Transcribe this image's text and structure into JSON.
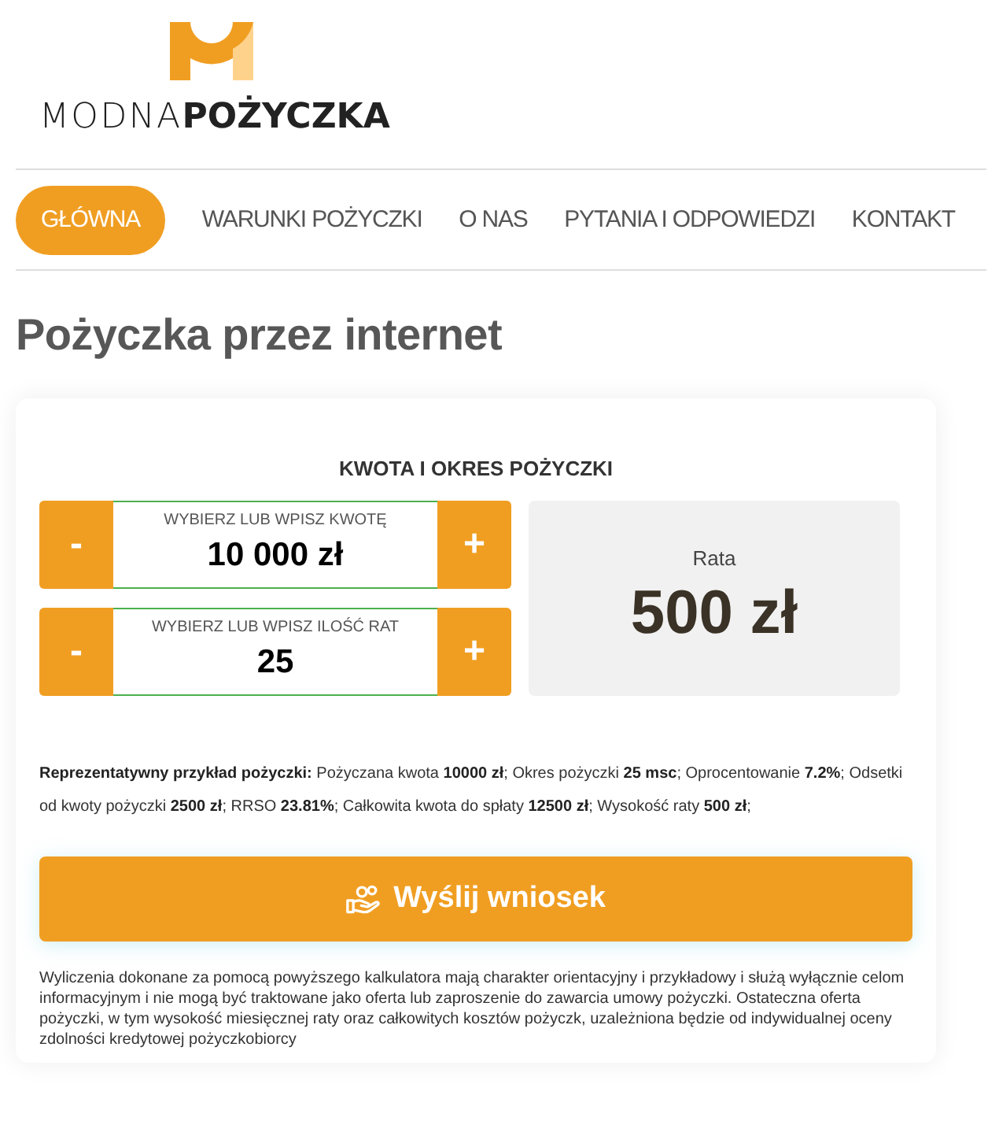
{
  "logo": {
    "text": "MODNA**POŻYCZKA**"
  },
  "nav": [
    {
      "label": "GŁÓWNA",
      "selected": true
    },
    {
      "label": "WARUNKI POŻYCZKI",
      "selected": false
    },
    {
      "label": "O NAS",
      "selected": false
    },
    {
      "label": "PYTANIA I ODPOWIEDZI",
      "selected": false
    },
    {
      "label": "KONTAKT",
      "selected": false
    }
  ],
  "page_title": "Pożyczka przez internet",
  "calculator": {
    "heading": "KWOTA I OKRES POŻYCZKI",
    "steppers": [
      {
        "label": "WYBIERZ LUB WPISZ KWOTĘ",
        "value": "10 000 zł",
        "minus": "-",
        "plus": "+"
      },
      {
        "label": "WYBIERZ LUB WPISZ ILOŚĆ RAT",
        "value": "25",
        "minus": "-",
        "plus": "+"
      }
    ],
    "result": {
      "label": "Rata",
      "value": "500 zł"
    },
    "example": "**Reprezentatywny przykład pożyczki:** Pożyczana kwota **10000 zł**; Okres pożyczki **25 msc**; Oprocentowanie **7.2%**; Odsetki od kwoty pożyczki **2500 zł**; RRSO **23.81%**; Całkowita kwota do spłaty **12500 zł**; Wysokość raty **500 zł**;",
    "submit_button": "Wyślij wniosek",
    "disclaimer": "Wyliczenia dokonane za pomocą powyższego kalkulatora mają charakter orientacyjny i przykładowy i służą wyłącznie celom informacyjnym i nie mogą być traktowane jako oferta lub zaproszenie do zawarcia umowy pożyczki. Ostateczna oferta pożyczki, w tym wysokość miesięcznej raty oraz całkowitych kosztów pożyczk, uzależniona będzie od indywidualnej oceny zdolności kredytowej pożyczkobiorcy"
  }
}
